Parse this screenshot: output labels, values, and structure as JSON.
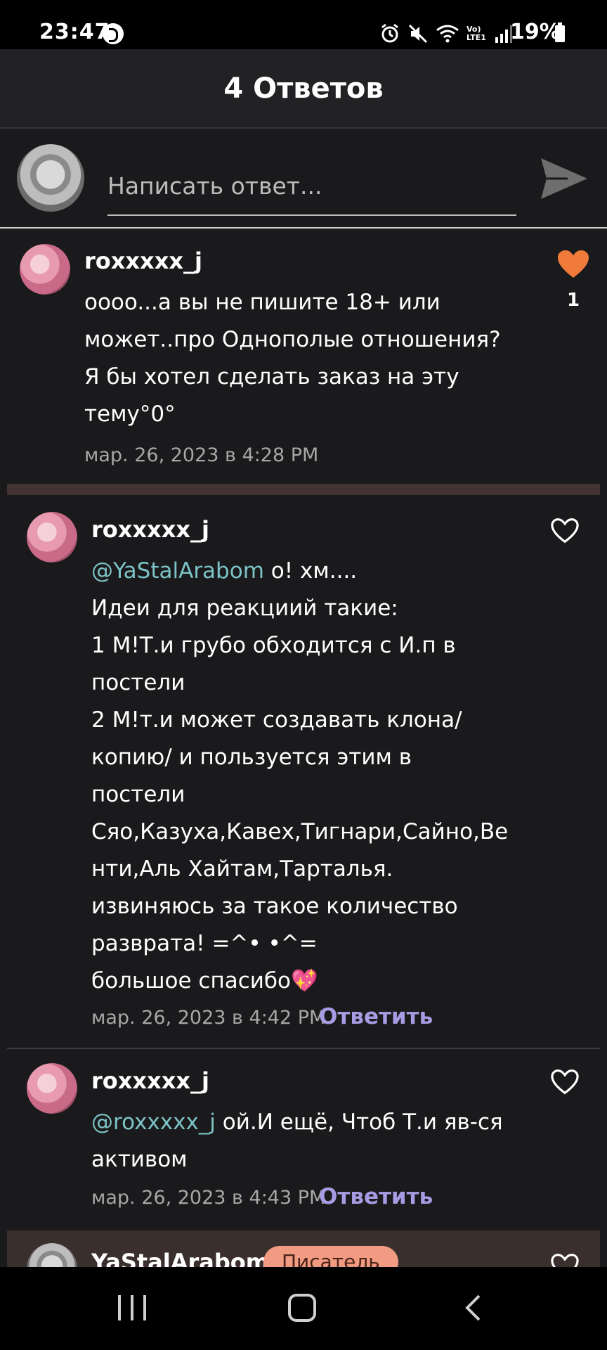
{
  "status_bar": {
    "time": "23:47",
    "battery": "19%",
    "network": "Vo) LTE1",
    "icons": [
      "shazam-icon",
      "alarm-icon",
      "mute-icon",
      "wifi-icon",
      "signal-icon",
      "battery-icon"
    ]
  },
  "header": {
    "title": "4 Ответов"
  },
  "composer": {
    "placeholder": "Написать ответ..."
  },
  "comments": [
    {
      "username": "roxxxxx_j",
      "text_lines": [
        "oooo...а вы не пишите 18+ или",
        "может..про Однополые отношения?",
        "Я бы хотел сделать заказ на эту",
        "тему°0°"
      ],
      "timestamp": "мар. 26, 2023 в 4:28 PM",
      "likes": "1",
      "liked": true
    },
    {
      "username": "roxxxxx_j",
      "mention": "@YaStalArabom",
      "first_line_rest": " о! хм....",
      "text_lines": [
        "Идеи для реакциий такие:",
        "1 М!Т.и грубо обходится с И.п в",
        "постели",
        "2 М!т.и может создавать клона/",
        "копию/ и пользуется этим в",
        "постели",
        "Сяо,Казуха,Кавех,Тигнари,Сайно,Ве",
        "нти,Аль Хайтам,Тарталья.",
        "извиняюсь за такое количество",
        "разврата! =^• •^=",
        "большое спасибо💖"
      ],
      "timestamp": "мар. 26, 2023 в 4:42 PM",
      "reply_label": "Ответить"
    },
    {
      "username": "roxxxxx_j",
      "mention": "@roxxxxx_j",
      "first_line_rest": " ой.И ещё, Чтоб Т.и яв-ся",
      "text_lines": [
        "активом"
      ],
      "timestamp": "мар. 26, 2023 в 4:43 PM",
      "reply_label": "Ответить"
    },
    {
      "username": "YaStalArabom",
      "badge": "Писатель"
    }
  ],
  "colors": {
    "background": "#1a191b",
    "header": "#222124",
    "mention": "#7cc3c6",
    "reply": "#a89be3",
    "heart_liked": "#f07a3a",
    "badge": "#f19c82"
  }
}
